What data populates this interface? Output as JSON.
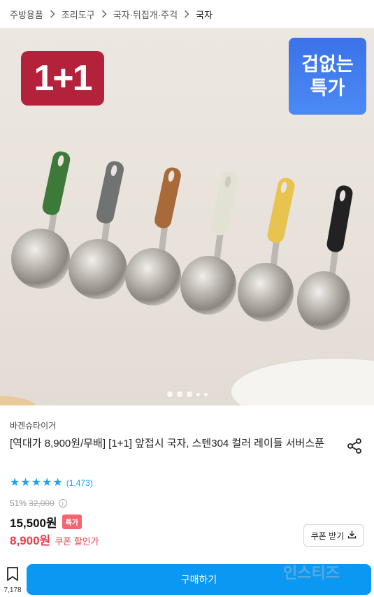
{
  "breadcrumb": {
    "items": [
      "주방용품",
      "조리도구",
      "국자·뒤집개·주걱",
      "국자"
    ]
  },
  "hero": {
    "badge_left": "1+1",
    "badge_right_line1": "겁없는",
    "badge_right_line2": "특가",
    "slide_count": 5,
    "active_slide": 1
  },
  "product": {
    "brand": "바겐슈타이거",
    "title": "[역대가 8,900원/무배] [1+1] 앞접시 국자, 스텐304 컬러 레이들 서버스푼",
    "rating": 5,
    "review_count": "(1,473)",
    "discount_rate": "51%",
    "original_price": "32,000",
    "price": "15,500원",
    "special_badge": "특가",
    "coupon_price": "8,900원",
    "coupon_text": "쿠폰 할인가",
    "coupon_button": "쿠폰 받기"
  },
  "bottom_bar": {
    "bookmark_count": "7,178",
    "buy_button": "구매하기",
    "watermark": "인스티즈"
  },
  "colors": {
    "accent_blue": "#0b98f2",
    "star_blue": "#1fa0f0",
    "sale_red": "#f23a4a",
    "badge_red": "#b3213a",
    "deal_blue": "#3b72e8"
  }
}
